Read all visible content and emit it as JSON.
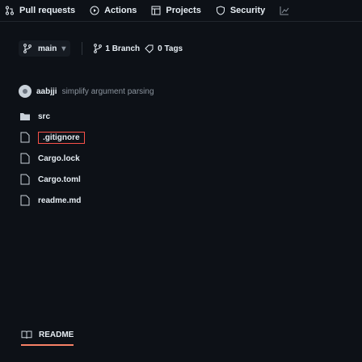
{
  "nav": {
    "pull_requests": "Pull requests",
    "actions": "Actions",
    "projects": "Projects",
    "security": "Security"
  },
  "branch": {
    "name": "main",
    "branches": "1 Branch",
    "tags": "0 Tags"
  },
  "commit": {
    "author": "aabjji",
    "message": "simplify argument parsing"
  },
  "files": [
    {
      "name": "src",
      "type": "dir"
    },
    {
      "name": ".gitignore",
      "type": "file"
    },
    {
      "name": "Cargo.lock",
      "type": "file"
    },
    {
      "name": "Cargo.toml",
      "type": "file"
    },
    {
      "name": "readme.md",
      "type": "file"
    }
  ],
  "readme": {
    "label": "README"
  },
  "colors": {
    "background": "#0d1117",
    "text": "#e6edf3",
    "muted": "#8b949e",
    "accent": "#f78166",
    "selected_border": "#f85149"
  }
}
